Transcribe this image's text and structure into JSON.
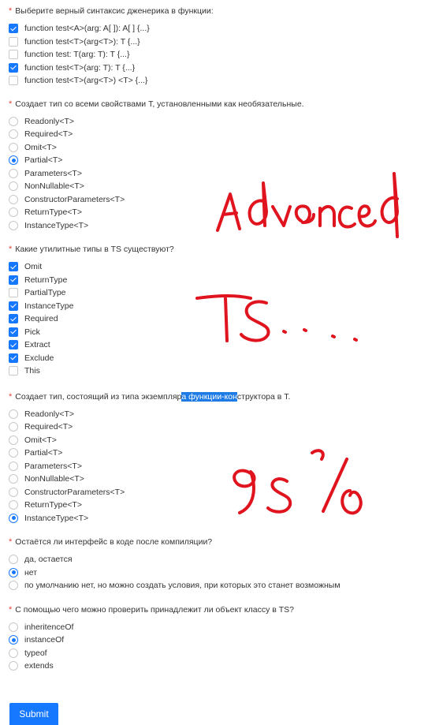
{
  "questions": [
    {
      "title": "Выберите верный синтаксис дженерика в функции:",
      "type": "checkbox",
      "options": [
        {
          "label": "function test<A>(arg: A[ ]): A[ ] {...}",
          "checked": true
        },
        {
          "label": "function test<T>(arg<T>): T {...}",
          "checked": false
        },
        {
          "label": "function test: T(arg: T): T {...}",
          "checked": false
        },
        {
          "label": "function test<T>(arg: T): T {...}",
          "checked": true
        },
        {
          "label": "function test<T>(arg<T>) <T> {...}",
          "checked": false
        }
      ]
    },
    {
      "title": "Создает тип со всеми свойствами T, установленными как необязательные.",
      "type": "radio",
      "options": [
        {
          "label": "Readonly<T>",
          "checked": false
        },
        {
          "label": "Required<T>",
          "checked": false
        },
        {
          "label": "Omit<T>",
          "checked": false
        },
        {
          "label": "Partial<T>",
          "checked": true
        },
        {
          "label": "Parameters<T>",
          "checked": false
        },
        {
          "label": "NonNullable<T>",
          "checked": false
        },
        {
          "label": "ConstructorParameters<T>",
          "checked": false
        },
        {
          "label": "ReturnType<T>",
          "checked": false
        },
        {
          "label": "InstanceType<T>",
          "checked": false
        }
      ]
    },
    {
      "title": "Какие утилитные типы в TS существуют?",
      "type": "checkbox",
      "options": [
        {
          "label": "Omit",
          "checked": true
        },
        {
          "label": "ReturnType",
          "checked": true
        },
        {
          "label": "PartialType",
          "checked": false
        },
        {
          "label": "InstanceType",
          "checked": true
        },
        {
          "label": "Required",
          "checked": true
        },
        {
          "label": "Pick",
          "checked": true
        },
        {
          "label": "Extract",
          "checked": true
        },
        {
          "label": "Exclude",
          "checked": true
        },
        {
          "label": "This",
          "checked": false
        }
      ]
    },
    {
      "title_before": "Создает тип, состоящий из типа экземпляр",
      "title_highlight": "а функции-кон",
      "title_after": "структора в T.",
      "type": "radio",
      "options": [
        {
          "label": "Readonly<T>",
          "checked": false
        },
        {
          "label": "Required<T>",
          "checked": false
        },
        {
          "label": "Omit<T>",
          "checked": false
        },
        {
          "label": "Partial<T>",
          "checked": false
        },
        {
          "label": "Parameters<T>",
          "checked": false
        },
        {
          "label": "NonNullable<T>",
          "checked": false
        },
        {
          "label": "ConstructorParameters<T>",
          "checked": false
        },
        {
          "label": "ReturnType<T>",
          "checked": false
        },
        {
          "label": "InstanceType<T>",
          "checked": true
        }
      ]
    },
    {
      "title": "Остаётся ли интерфейс в коде после компиляции?",
      "type": "radio",
      "options": [
        {
          "label": "да, остается",
          "checked": false
        },
        {
          "label": "нет",
          "checked": true
        },
        {
          "label": "по умолчанию нет, но можно создать условия, при которых это станет возможным",
          "checked": false
        }
      ]
    },
    {
      "title": "С помощью чего можно проверить принадлежит ли объект классу в TS?",
      "type": "radio",
      "options": [
        {
          "label": "inheritenceOf",
          "checked": false
        },
        {
          "label": "instanceOf",
          "checked": true
        },
        {
          "label": "typeof",
          "checked": false
        },
        {
          "label": "extends",
          "checked": false
        }
      ]
    }
  ],
  "submit_label": "Submit",
  "required_mark": "*",
  "colors": {
    "accent": "#1677ff",
    "required": "#e8453c",
    "annotation": "#e0141e",
    "highlight": "#1e7be6"
  },
  "annotations": [
    "Advanced",
    "TS....",
    "95%"
  ]
}
